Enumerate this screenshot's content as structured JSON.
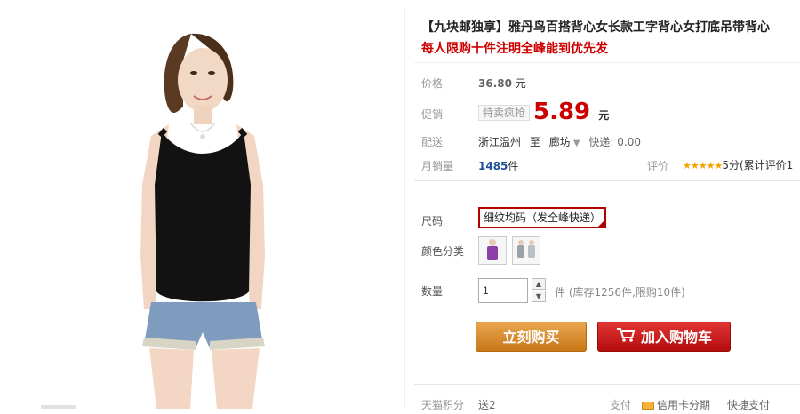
{
  "product": {
    "title": "【九块邮独享】雅丹鸟百搭背心女长款工字背心女打底吊带背心",
    "promo": "每人限购十件注明全峰能到优先发"
  },
  "price": {
    "label": "价格",
    "original": "36.80",
    "unit": "元"
  },
  "sale": {
    "label": "促销",
    "tag": "特卖疯抢",
    "price": "5.89",
    "unit": "元"
  },
  "shipping": {
    "label": "配送",
    "from": "浙江温州",
    "to_word": "至",
    "to": "廊坊",
    "fee": "快递: 0.00"
  },
  "sales": {
    "label": "月销量",
    "count": "1485",
    "unit": "件",
    "rating_label": "评价",
    "stars": "★★★★★",
    "rating_text": "5分(累计评价1"
  },
  "options": {
    "size_label": "尺码",
    "size_value": "细纹均码（发全峰快递）",
    "color_label": "颜色分类",
    "colors": [
      "purple",
      "gray"
    ],
    "qty_label": "数量",
    "qty_value": "1",
    "stock_text": "件 (库存1256件,限购10件)"
  },
  "buttons": {
    "buy": "立刻购买",
    "cart": "加入购物车"
  },
  "footer": {
    "points_label": "天猫积分",
    "points_value": "送2",
    "pay_label": "支付",
    "credit": "信用卡分期",
    "express": "快捷支付"
  },
  "colors": {
    "price_red": "#cc0000",
    "buy_orange": "#d88a2e",
    "cart_red": "#c81e1e"
  }
}
